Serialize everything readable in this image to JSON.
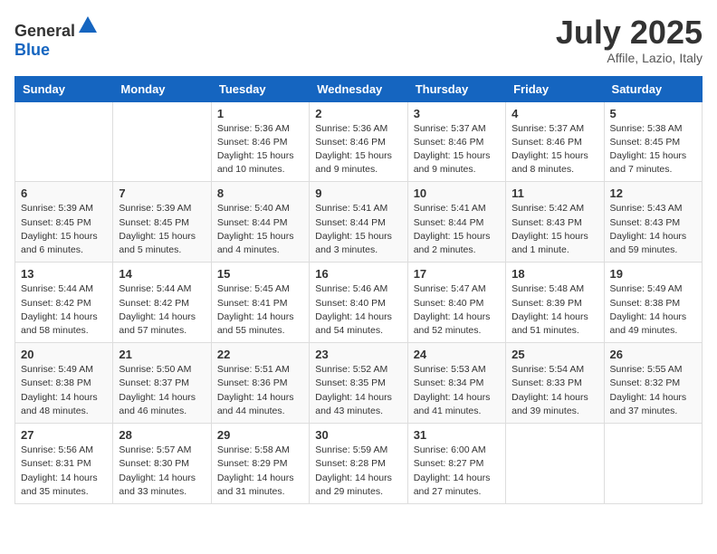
{
  "header": {
    "logo_general": "General",
    "logo_blue": "Blue",
    "month": "July 2025",
    "location": "Affile, Lazio, Italy"
  },
  "weekdays": [
    "Sunday",
    "Monday",
    "Tuesday",
    "Wednesday",
    "Thursday",
    "Friday",
    "Saturday"
  ],
  "weeks": [
    [
      {
        "day": "",
        "info": ""
      },
      {
        "day": "",
        "info": ""
      },
      {
        "day": "1",
        "info": "Sunrise: 5:36 AM\nSunset: 8:46 PM\nDaylight: 15 hours and 10 minutes."
      },
      {
        "day": "2",
        "info": "Sunrise: 5:36 AM\nSunset: 8:46 PM\nDaylight: 15 hours and 9 minutes."
      },
      {
        "day": "3",
        "info": "Sunrise: 5:37 AM\nSunset: 8:46 PM\nDaylight: 15 hours and 9 minutes."
      },
      {
        "day": "4",
        "info": "Sunrise: 5:37 AM\nSunset: 8:46 PM\nDaylight: 15 hours and 8 minutes."
      },
      {
        "day": "5",
        "info": "Sunrise: 5:38 AM\nSunset: 8:45 PM\nDaylight: 15 hours and 7 minutes."
      }
    ],
    [
      {
        "day": "6",
        "info": "Sunrise: 5:39 AM\nSunset: 8:45 PM\nDaylight: 15 hours and 6 minutes."
      },
      {
        "day": "7",
        "info": "Sunrise: 5:39 AM\nSunset: 8:45 PM\nDaylight: 15 hours and 5 minutes."
      },
      {
        "day": "8",
        "info": "Sunrise: 5:40 AM\nSunset: 8:44 PM\nDaylight: 15 hours and 4 minutes."
      },
      {
        "day": "9",
        "info": "Sunrise: 5:41 AM\nSunset: 8:44 PM\nDaylight: 15 hours and 3 minutes."
      },
      {
        "day": "10",
        "info": "Sunrise: 5:41 AM\nSunset: 8:44 PM\nDaylight: 15 hours and 2 minutes."
      },
      {
        "day": "11",
        "info": "Sunrise: 5:42 AM\nSunset: 8:43 PM\nDaylight: 15 hours and 1 minute."
      },
      {
        "day": "12",
        "info": "Sunrise: 5:43 AM\nSunset: 8:43 PM\nDaylight: 14 hours and 59 minutes."
      }
    ],
    [
      {
        "day": "13",
        "info": "Sunrise: 5:44 AM\nSunset: 8:42 PM\nDaylight: 14 hours and 58 minutes."
      },
      {
        "day": "14",
        "info": "Sunrise: 5:44 AM\nSunset: 8:42 PM\nDaylight: 14 hours and 57 minutes."
      },
      {
        "day": "15",
        "info": "Sunrise: 5:45 AM\nSunset: 8:41 PM\nDaylight: 14 hours and 55 minutes."
      },
      {
        "day": "16",
        "info": "Sunrise: 5:46 AM\nSunset: 8:40 PM\nDaylight: 14 hours and 54 minutes."
      },
      {
        "day": "17",
        "info": "Sunrise: 5:47 AM\nSunset: 8:40 PM\nDaylight: 14 hours and 52 minutes."
      },
      {
        "day": "18",
        "info": "Sunrise: 5:48 AM\nSunset: 8:39 PM\nDaylight: 14 hours and 51 minutes."
      },
      {
        "day": "19",
        "info": "Sunrise: 5:49 AM\nSunset: 8:38 PM\nDaylight: 14 hours and 49 minutes."
      }
    ],
    [
      {
        "day": "20",
        "info": "Sunrise: 5:49 AM\nSunset: 8:38 PM\nDaylight: 14 hours and 48 minutes."
      },
      {
        "day": "21",
        "info": "Sunrise: 5:50 AM\nSunset: 8:37 PM\nDaylight: 14 hours and 46 minutes."
      },
      {
        "day": "22",
        "info": "Sunrise: 5:51 AM\nSunset: 8:36 PM\nDaylight: 14 hours and 44 minutes."
      },
      {
        "day": "23",
        "info": "Sunrise: 5:52 AM\nSunset: 8:35 PM\nDaylight: 14 hours and 43 minutes."
      },
      {
        "day": "24",
        "info": "Sunrise: 5:53 AM\nSunset: 8:34 PM\nDaylight: 14 hours and 41 minutes."
      },
      {
        "day": "25",
        "info": "Sunrise: 5:54 AM\nSunset: 8:33 PM\nDaylight: 14 hours and 39 minutes."
      },
      {
        "day": "26",
        "info": "Sunrise: 5:55 AM\nSunset: 8:32 PM\nDaylight: 14 hours and 37 minutes."
      }
    ],
    [
      {
        "day": "27",
        "info": "Sunrise: 5:56 AM\nSunset: 8:31 PM\nDaylight: 14 hours and 35 minutes."
      },
      {
        "day": "28",
        "info": "Sunrise: 5:57 AM\nSunset: 8:30 PM\nDaylight: 14 hours and 33 minutes."
      },
      {
        "day": "29",
        "info": "Sunrise: 5:58 AM\nSunset: 8:29 PM\nDaylight: 14 hours and 31 minutes."
      },
      {
        "day": "30",
        "info": "Sunrise: 5:59 AM\nSunset: 8:28 PM\nDaylight: 14 hours and 29 minutes."
      },
      {
        "day": "31",
        "info": "Sunrise: 6:00 AM\nSunset: 8:27 PM\nDaylight: 14 hours and 27 minutes."
      },
      {
        "day": "",
        "info": ""
      },
      {
        "day": "",
        "info": ""
      }
    ]
  ]
}
